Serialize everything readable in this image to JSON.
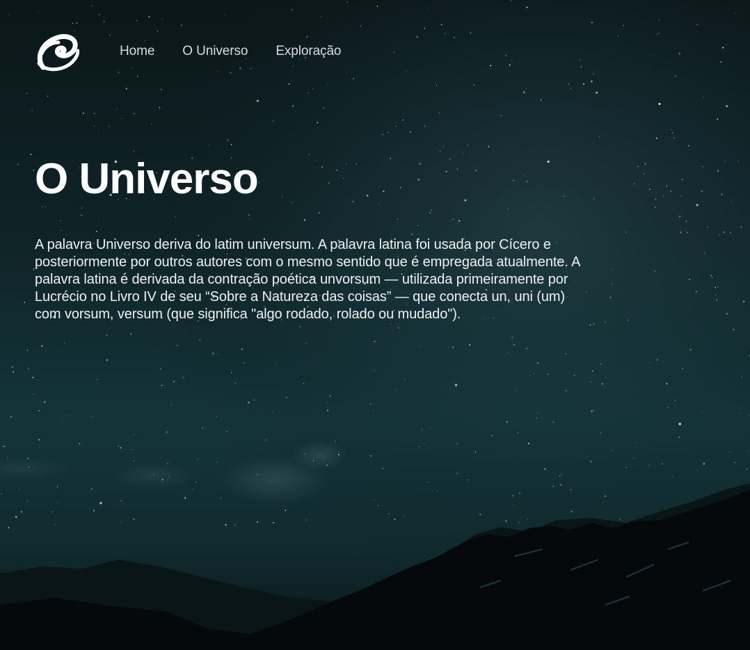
{
  "nav": {
    "logo_icon": "spiral-galaxy-icon",
    "items": [
      {
        "label": "Home"
      },
      {
        "label": "O Universo"
      },
      {
        "label": "Exploração"
      }
    ]
  },
  "main": {
    "title": "O Universo",
    "paragraph": "A palavra Universo deriva do latim universum. A palavra latina foi usada por Cícero e posteriormente por outros autores com o mesmo sentido que é empregada atualmente. A palavra latina é derivada da contração poética unvorsum — utilizada primeiramente por Lucrécio no Livro IV de seu “Sobre a Natureza das coisas” — que conecta un, uni (um) com vorsum, versum (que significa \"algo rodado, rolado ou mudado\")."
  },
  "colors": {
    "sky_top": "#0b1a1d",
    "sky_mid": "#14353a",
    "mountains": "#05080a",
    "text": "#ffffff",
    "nav_text": "#d6dde0"
  }
}
